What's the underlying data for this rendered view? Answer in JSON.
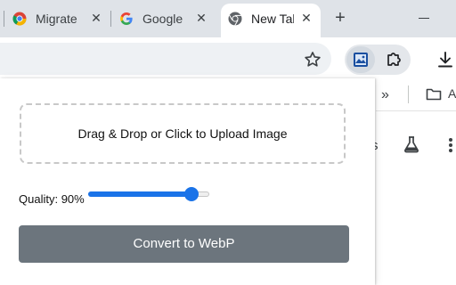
{
  "tabs": [
    {
      "title": "Migrate",
      "icon": "chrome-icon"
    },
    {
      "title": "Google",
      "icon": "google-icon"
    },
    {
      "title": "New Tab",
      "icon": "chrome-new-tab-icon"
    }
  ],
  "toolbar": {
    "omnibox_value": "",
    "bookmark_star_icon": "star-icon",
    "extension_icon": "image-converter-icon",
    "extensions_menu_icon": "puzzle-icon",
    "downloads_icon": "download-icon"
  },
  "bookmarks_bar": {
    "overflow_label": "»",
    "folder_label": "A"
  },
  "page_behind": {
    "clipped_text": "s",
    "icons": [
      "flask-icon",
      "apps-grid-icon"
    ]
  },
  "popup": {
    "dropzone_text": "Drag & Drop or Click to Upload Image",
    "quality_label": "Quality:",
    "quality_value": "90%",
    "quality_fraction": 0.9,
    "convert_button": "Convert to WebP"
  },
  "colors": {
    "accent": "#1a73e8",
    "button": "#6c757d",
    "tabstrip": "#dfe3e8"
  }
}
